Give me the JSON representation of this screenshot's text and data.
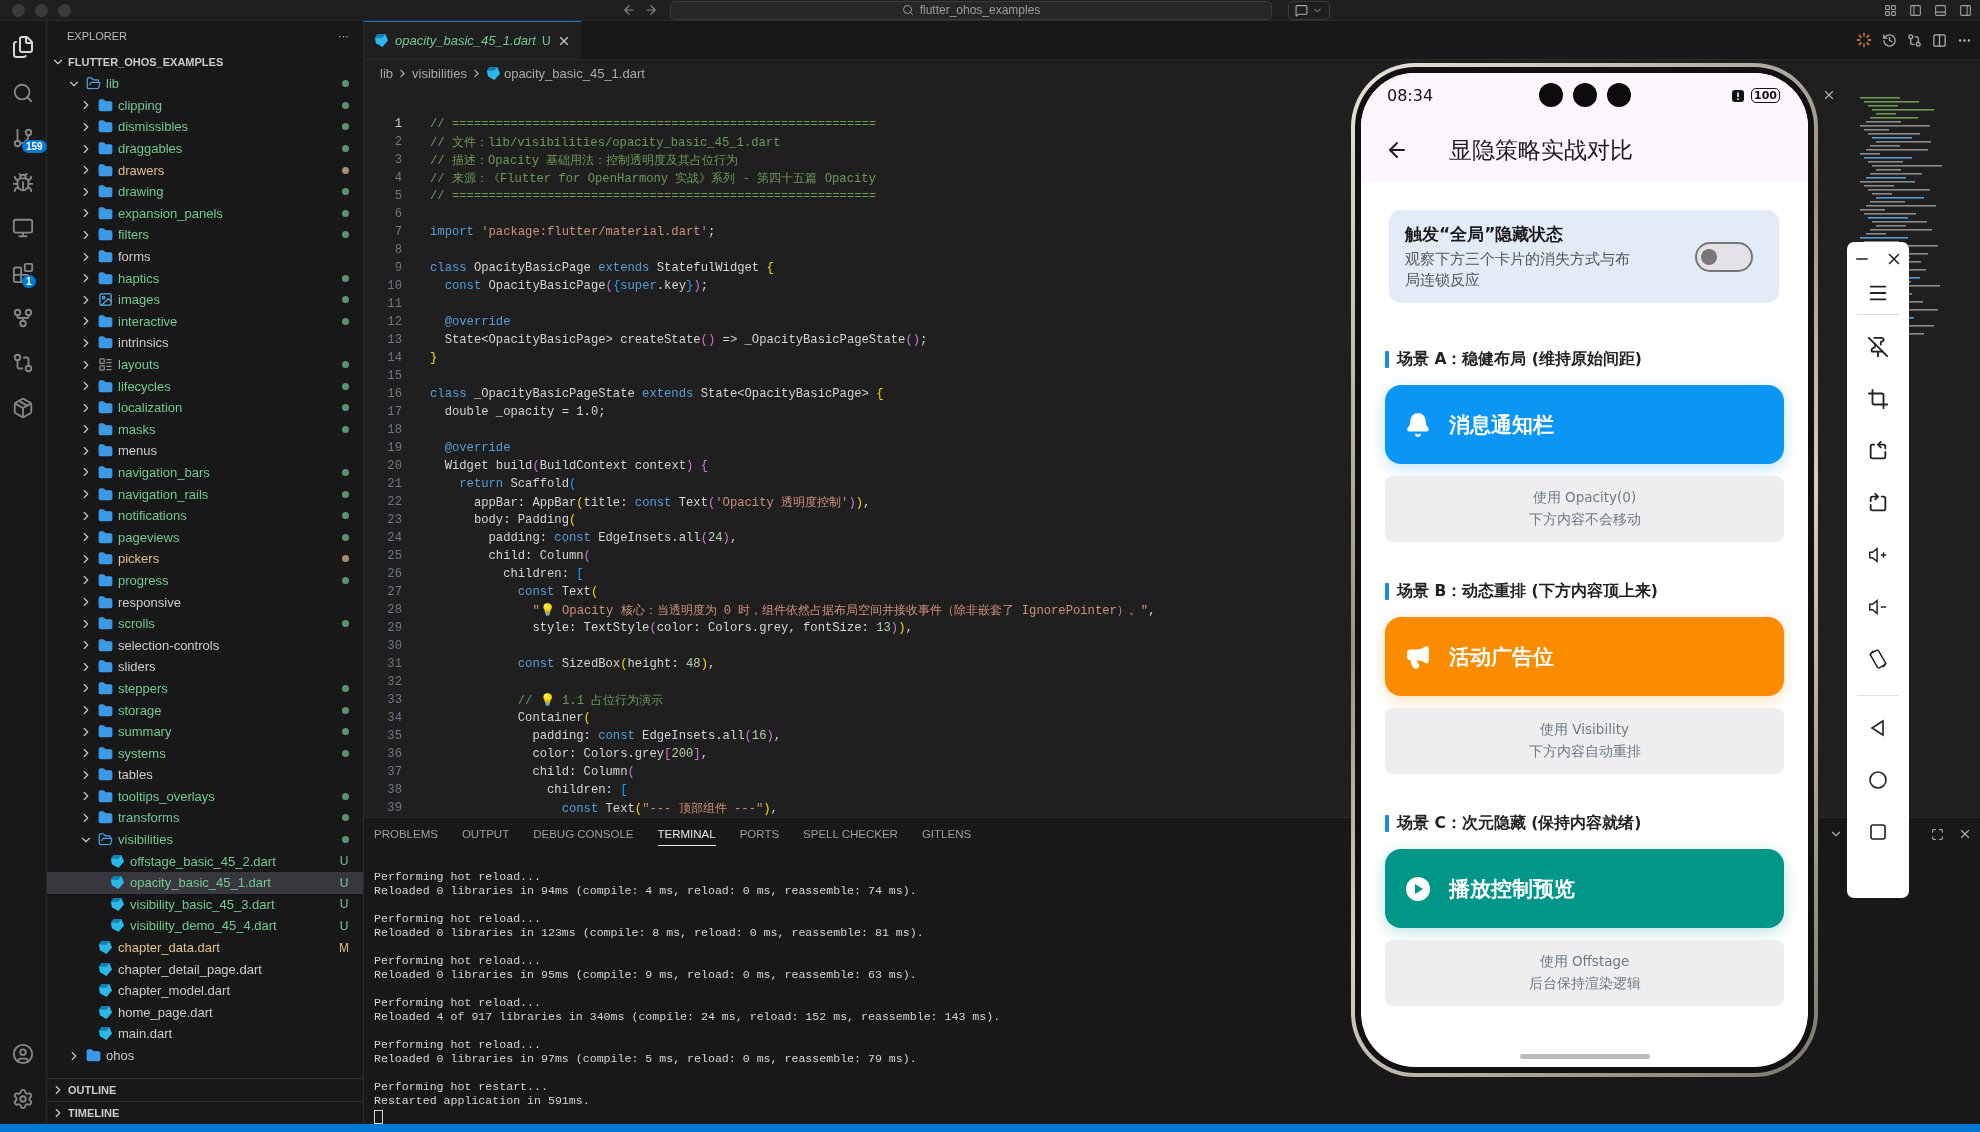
{
  "title_bar": {
    "search": "flutter_ohos_examples"
  },
  "activity_bar": {
    "badges": [
      "159",
      "1"
    ]
  },
  "explorer": {
    "header": "EXPLORER",
    "more": "···",
    "root": "FLUTTER_OHOS_EXAMPLES",
    "tree": [
      {
        "name": "lib",
        "kind": "folder",
        "expanded": true,
        "selected": false,
        "color": "#73c991",
        "dot": true,
        "children": [
          {
            "name": "clipping",
            "kind": "folder",
            "expanded": false,
            "selected": false,
            "color": "#73c991",
            "dot": true
          },
          {
            "name": "dismissibles",
            "kind": "folder",
            "expanded": false,
            "selected": false,
            "color": "#73c991",
            "dot": true
          },
          {
            "name": "draggables",
            "kind": "folder",
            "expanded": false,
            "selected": false,
            "color": "#73c991",
            "dot": true
          },
          {
            "name": "drawers",
            "kind": "folder",
            "expanded": false,
            "selected": false,
            "color": "#e2c08d",
            "dot": true
          },
          {
            "name": "drawing",
            "kind": "folder",
            "expanded": false,
            "selected": false,
            "color": "#73c991",
            "dot": true
          },
          {
            "name": "expansion_panels",
            "kind": "folder",
            "expanded": false,
            "selected": false,
            "color": "#73c991",
            "dot": true
          },
          {
            "name": "filters",
            "kind": "folder",
            "expanded": false,
            "selected": false,
            "color": "#73c991",
            "dot": true
          },
          {
            "name": "forms",
            "kind": "folder",
            "expanded": false,
            "selected": false,
            "color": "#cccccc",
            "dot": false
          },
          {
            "name": "haptics",
            "kind": "folder",
            "expanded": false,
            "selected": false,
            "color": "#73c991",
            "dot": true
          },
          {
            "name": "images",
            "kind": "imagefolder",
            "expanded": false,
            "selected": false,
            "color": "#73c991",
            "dot": true
          },
          {
            "name": "interactive",
            "kind": "folder",
            "expanded": false,
            "selected": false,
            "color": "#73c991",
            "dot": true
          },
          {
            "name": "intrinsics",
            "kind": "folder",
            "expanded": false,
            "selected": false,
            "color": "#cccccc",
            "dot": false
          },
          {
            "name": "layouts",
            "kind": "layoutfolder",
            "expanded": false,
            "selected": false,
            "color": "#73c991",
            "dot": true
          },
          {
            "name": "lifecycles",
            "kind": "folder",
            "expanded": false,
            "selected": false,
            "color": "#73c991",
            "dot": true
          },
          {
            "name": "localization",
            "kind": "folder",
            "expanded": false,
            "selected": false,
            "color": "#73c991",
            "dot": true
          },
          {
            "name": "masks",
            "kind": "folder",
            "expanded": false,
            "selected": false,
            "color": "#73c991",
            "dot": true
          },
          {
            "name": "menus",
            "kind": "folder",
            "expanded": false,
            "selected": false,
            "color": "#cccccc",
            "dot": false
          },
          {
            "name": "navigation_bars",
            "kind": "folder",
            "expanded": false,
            "selected": false,
            "color": "#73c991",
            "dot": true
          },
          {
            "name": "navigation_rails",
            "kind": "folder",
            "expanded": false,
            "selected": false,
            "color": "#73c991",
            "dot": true
          },
          {
            "name": "notifications",
            "kind": "folder",
            "expanded": false,
            "selected": false,
            "color": "#73c991",
            "dot": true
          },
          {
            "name": "pageviews",
            "kind": "folder",
            "expanded": false,
            "selected": false,
            "color": "#73c991",
            "dot": true
          },
          {
            "name": "pickers",
            "kind": "folder",
            "expanded": false,
            "selected": false,
            "color": "#e2c08d",
            "dot": true
          },
          {
            "name": "progress",
            "kind": "folder",
            "expanded": false,
            "selected": false,
            "color": "#73c991",
            "dot": true
          },
          {
            "name": "responsive",
            "kind": "folder",
            "expanded": false,
            "selected": false,
            "color": "#cccccc",
            "dot": false
          },
          {
            "name": "scrolls",
            "kind": "folder",
            "expanded": false,
            "selected": false,
            "color": "#73c991",
            "dot": true
          },
          {
            "name": "selection-controls",
            "kind": "folder",
            "expanded": false,
            "selected": false,
            "color": "#cccccc",
            "dot": false
          },
          {
            "name": "sliders",
            "kind": "folder",
            "expanded": false,
            "selected": false,
            "color": "#cccccc",
            "dot": false
          },
          {
            "name": "steppers",
            "kind": "folder",
            "expanded": false,
            "selected": false,
            "color": "#73c991",
            "dot": true
          },
          {
            "name": "storage",
            "kind": "folder",
            "expanded": false,
            "selected": false,
            "color": "#73c991",
            "dot": true
          },
          {
            "name": "summary",
            "kind": "folder",
            "expanded": false,
            "selected": false,
            "color": "#73c991",
            "dot": true
          },
          {
            "name": "systems",
            "kind": "folder",
            "expanded": false,
            "selected": false,
            "color": "#73c991",
            "dot": true
          },
          {
            "name": "tables",
            "kind": "folder",
            "expanded": false,
            "selected": false,
            "color": "#cccccc",
            "dot": false
          },
          {
            "name": "tooltips_overlays",
            "kind": "folder",
            "expanded": false,
            "selected": false,
            "color": "#73c991",
            "dot": true
          },
          {
            "name": "transforms",
            "kind": "folder",
            "expanded": false,
            "selected": false,
            "color": "#73c991",
            "dot": true
          },
          {
            "name": "visibilities",
            "kind": "folder",
            "expanded": true,
            "selected": false,
            "color": "#73c991",
            "dot": true,
            "children": [
              {
                "name": "offstage_basic_45_2.dart",
                "kind": "dart",
                "selected": false,
                "color": "#73c991",
                "badge": "U"
              },
              {
                "name": "opacity_basic_45_1.dart",
                "kind": "dart",
                "selected": true,
                "color": "#73c991",
                "badge": "U"
              },
              {
                "name": "visibility_basic_45_3.dart",
                "kind": "dart",
                "selected": false,
                "color": "#73c991",
                "badge": "U"
              },
              {
                "name": "visibility_demo_45_4.dart",
                "kind": "dart",
                "selected": false,
                "color": "#73c991",
                "badge": "U"
              }
            ]
          },
          {
            "name": "chapter_data.dart",
            "kind": "dart",
            "selected": false,
            "color": "#e2c08d",
            "badge": "M"
          },
          {
            "name": "chapter_detail_page.dart",
            "kind": "dart",
            "selected": false,
            "color": "#cccccc"
          },
          {
            "name": "chapter_model.dart",
            "kind": "dart",
            "selected": false,
            "color": "#cccccc"
          },
          {
            "name": "home_page.dart",
            "kind": "dart",
            "selected": false,
            "color": "#cccccc"
          },
          {
            "name": "main.dart",
            "kind": "dart",
            "selected": false,
            "color": "#cccccc"
          }
        ]
      },
      {
        "name": "ohos",
        "kind": "folder",
        "expanded": false,
        "selected": false,
        "color": "#cccccc",
        "dot": false
      }
    ],
    "sections": [
      "OUTLINE",
      "TIMELINE"
    ]
  },
  "editor": {
    "tab": {
      "label": "opacity_basic_45_1.dart",
      "badge": "U"
    },
    "breadcrumb": [
      "lib",
      "visibilities",
      "opacity_basic_45_1.dart"
    ],
    "lines": [
      {
        "n": "1",
        "tokens": [
          {
            "kind": "c",
            "t": "// =========================================================="
          }
        ]
      },
      {
        "n": "2",
        "tokens": [
          {
            "kind": "c",
            "t": "// 文件：lib/visibilities/opacity_basic_45_1.dart"
          }
        ]
      },
      {
        "n": "3",
        "tokens": [
          {
            "kind": "c",
            "t": "// 描述：Opacity 基础用法：控制透明度及其占位行为"
          }
        ]
      },
      {
        "n": "4",
        "tokens": [
          {
            "kind": "c",
            "t": "// 来源：《Flutter for OpenHarmony 实战》系列 - 第四十五篇 Opacity"
          }
        ]
      },
      {
        "n": "5",
        "tokens": [
          {
            "kind": "c",
            "t": "// =========================================================="
          }
        ]
      },
      {
        "n": "6"
      },
      {
        "n": "7",
        "tokens": [
          {
            "kind": "f",
            "t": "import"
          },
          {
            "kind": "s",
            "t": " 'package:flutter/material.dart'"
          },
          {
            "kind": "p",
            "t": ";"
          }
        ]
      },
      {
        "n": "8"
      },
      {
        "n": "9",
        "tokens": [
          {
            "kind": "k",
            "t": "class"
          },
          {
            "kind": "p",
            "t": " OpacityBasicPage "
          },
          {
            "kind": "k",
            "t": "extends"
          },
          {
            "kind": "p",
            "t": " StatefulWidget "
          },
          {
            "kind": "y",
            "t": "{"
          }
        ]
      },
      {
        "n": "10",
        "tokens": [
          {
            "kind": "k",
            "t": "  const"
          },
          {
            "kind": "p",
            "t": " OpacityBasicPage"
          },
          {
            "kind": "m",
            "t": "("
          },
          {
            "kind": "b",
            "t": "{"
          },
          {
            "kind": "k",
            "t": "super"
          },
          {
            "kind": "p",
            "t": ".key"
          },
          {
            "kind": "b",
            "t": "}"
          },
          {
            "kind": "m",
            "t": ")"
          },
          {
            "kind": "p",
            "t": ";"
          }
        ]
      },
      {
        "n": "11"
      },
      {
        "n": "12",
        "tokens": [
          {
            "kind": "k",
            "t": "  @override"
          }
        ]
      },
      {
        "n": "13",
        "tokens": [
          {
            "kind": "p",
            "t": "  State<OpacityBasicPage> createState"
          },
          {
            "kind": "m",
            "t": "()"
          },
          {
            "kind": "p",
            "t": " => _OpacityBasicPageState"
          },
          {
            "kind": "m",
            "t": "()"
          },
          {
            "kind": "p",
            "t": ";"
          }
        ]
      },
      {
        "n": "14",
        "tokens": [
          {
            "kind": "y",
            "t": "}"
          }
        ]
      },
      {
        "n": "15"
      },
      {
        "n": "16",
        "tokens": [
          {
            "kind": "k",
            "t": "class"
          },
          {
            "kind": "p",
            "t": " _OpacityBasicPageState "
          },
          {
            "kind": "k",
            "t": "extends"
          },
          {
            "kind": "p",
            "t": " State<OpacityBasicPage> "
          },
          {
            "kind": "y",
            "t": "{"
          }
        ]
      },
      {
        "n": "17",
        "tokens": [
          {
            "kind": "p",
            "t": "  double _opacity = 1.0;"
          }
        ]
      },
      {
        "n": "18"
      },
      {
        "n": "19",
        "tokens": [
          {
            "kind": "k",
            "t": "  @override"
          }
        ]
      },
      {
        "n": "20",
        "tokens": [
          {
            "kind": "p",
            "t": "  Widget build"
          },
          {
            "kind": "m",
            "t": "("
          },
          {
            "kind": "p",
            "t": "BuildContext context"
          },
          {
            "kind": "m",
            "t": ")"
          },
          {
            "kind": "m",
            "t": " {"
          }
        ]
      },
      {
        "n": "21",
        "tokens": [
          {
            "kind": "f",
            "t": "    return"
          },
          {
            "kind": "p",
            "t": " Scaffold"
          },
          {
            "kind": "b",
            "t": "("
          }
        ]
      },
      {
        "n": "22",
        "tokens": [
          {
            "kind": "p",
            "t": "      appBar: AppBar"
          },
          {
            "kind": "y",
            "t": "("
          },
          {
            "kind": "p",
            "t": "title: "
          },
          {
            "kind": "k",
            "t": "const"
          },
          {
            "kind": "p",
            "t": " Text"
          },
          {
            "kind": "m",
            "t": "("
          },
          {
            "kind": "s",
            "t": "'Opacity 透明度控制'"
          },
          {
            "kind": "m",
            "t": ")"
          },
          {
            "kind": "y",
            "t": ")"
          },
          {
            "kind": "p",
            "t": ","
          }
        ]
      },
      {
        "n": "23",
        "tokens": [
          {
            "kind": "p",
            "t": "      body: Padding"
          },
          {
            "kind": "y",
            "t": "("
          }
        ]
      },
      {
        "n": "24",
        "tokens": [
          {
            "kind": "p",
            "t": "        padding: "
          },
          {
            "kind": "k",
            "t": "const"
          },
          {
            "kind": "p",
            "t": " EdgeInsets.all"
          },
          {
            "kind": "m",
            "t": "("
          },
          {
            "kind": "n",
            "t": "24"
          },
          {
            "kind": "m",
            "t": ")"
          },
          {
            "kind": "p",
            "t": ","
          }
        ]
      },
      {
        "n": "25",
        "tokens": [
          {
            "kind": "p",
            "t": "        child: Column"
          },
          {
            "kind": "m",
            "t": "("
          }
        ]
      },
      {
        "n": "26",
        "tokens": [
          {
            "kind": "p",
            "t": "          children: "
          },
          {
            "kind": "b",
            "t": "["
          }
        ]
      },
      {
        "n": "27",
        "tokens": [
          {
            "kind": "k",
            "t": "            const"
          },
          {
            "kind": "p",
            "t": " Text"
          },
          {
            "kind": "y",
            "t": "("
          }
        ]
      },
      {
        "n": "28",
        "tokens": [
          {
            "kind": "s",
            "t": "              \"💡 Opacity 核心：当透明度为 0 时，组件依然占据布局空间并接收事件（除非嵌套了 IgnorePointer）。\""
          },
          {
            "kind": "p",
            "t": ","
          }
        ]
      },
      {
        "n": "29",
        "tokens": [
          {
            "kind": "p",
            "t": "              style: TextStyle"
          },
          {
            "kind": "m",
            "t": "("
          },
          {
            "kind": "p",
            "t": "color: Colors.grey, fontSize: "
          },
          {
            "kind": "n",
            "t": "13"
          },
          {
            "kind": "m",
            "t": ")"
          },
          {
            "kind": "y",
            "t": ")"
          },
          {
            "kind": "p",
            "t": ","
          }
        ]
      },
      {
        "n": "30"
      },
      {
        "n": "31",
        "tokens": [
          {
            "kind": "k",
            "t": "            const"
          },
          {
            "kind": "p",
            "t": " SizedBox"
          },
          {
            "kind": "y",
            "t": "("
          },
          {
            "kind": "p",
            "t": "height: "
          },
          {
            "kind": "n",
            "t": "48"
          },
          {
            "kind": "y",
            "t": ")"
          },
          {
            "kind": "p",
            "t": ","
          }
        ]
      },
      {
        "n": "32"
      },
      {
        "n": "33",
        "tokens": [
          {
            "kind": "c",
            "t": "            // 💡 1.1 占位行为演示"
          }
        ]
      },
      {
        "n": "34",
        "tokens": [
          {
            "kind": "p",
            "t": "            Container"
          },
          {
            "kind": "y",
            "t": "("
          }
        ]
      },
      {
        "n": "35",
        "tokens": [
          {
            "kind": "p",
            "t": "              padding: "
          },
          {
            "kind": "k",
            "t": "const"
          },
          {
            "kind": "p",
            "t": " EdgeInsets.all"
          },
          {
            "kind": "m",
            "t": "("
          },
          {
            "kind": "n",
            "t": "16"
          },
          {
            "kind": "m",
            "t": ")"
          },
          {
            "kind": "p",
            "t": ","
          }
        ]
      },
      {
        "n": "36",
        "tokens": [
          {
            "kind": "p",
            "t": "              color: Colors.grey"
          },
          {
            "kind": "m",
            "t": "["
          },
          {
            "kind": "n",
            "t": "200"
          },
          {
            "kind": "m",
            "t": "]"
          },
          {
            "kind": "p",
            "t": ","
          }
        ]
      },
      {
        "n": "37",
        "tokens": [
          {
            "kind": "p",
            "t": "              child: Column"
          },
          {
            "kind": "m",
            "t": "("
          }
        ]
      },
      {
        "n": "38",
        "tokens": [
          {
            "kind": "p",
            "t": "                children: "
          },
          {
            "kind": "b",
            "t": "["
          }
        ]
      },
      {
        "n": "39",
        "tokens": [
          {
            "kind": "k",
            "t": "                  const"
          },
          {
            "kind": "p",
            "t": " Text"
          },
          {
            "kind": "y",
            "t": "("
          },
          {
            "kind": "s",
            "t": "\"--- 顶部组件 ---\""
          },
          {
            "kind": "y",
            "t": ")"
          },
          {
            "kind": "p",
            "t": ","
          }
        ]
      }
    ]
  },
  "panel": {
    "tabs": [
      {
        "label": "PROBLEMS",
        "selected": false
      },
      {
        "label": "OUTPUT",
        "selected": false
      },
      {
        "label": "DEBUG CONSOLE",
        "selected": false
      },
      {
        "label": "TERMINAL",
        "selected": true
      },
      {
        "label": "PORTS",
        "selected": false
      },
      {
        "label": "SPELL CHECKER",
        "selected": false
      },
      {
        "label": "GITLENS",
        "selected": false
      }
    ],
    "terminal": [
      {
        "command": "Performing hot reload...",
        "result": "Reloaded 0 libraries in 94ms (compile: 4 ms, reload: 0 ms, reassemble: 74 ms)."
      },
      {
        "command": "Performing hot reload...",
        "result": "Reloaded 0 libraries in 123ms (compile: 8 ms, reload: 0 ms, reassemble: 81 ms)."
      },
      {
        "command": "Performing hot reload...",
        "result": "Reloaded 0 libraries in 95ms (compile: 9 ms, reload: 0 ms, reassemble: 63 ms)."
      },
      {
        "command": "Performing hot reload...",
        "result": "Reloaded 4 of 917 libraries in 340ms (compile: 24 ms, reload: 152 ms, reassemble: 143 ms)."
      },
      {
        "command": "Performing hot reload...",
        "result": "Reloaded 0 libraries in 97ms (compile: 5 ms, reload: 0 ms, reassemble: 79 ms)."
      },
      {
        "command": "Performing hot restart...",
        "result": "Restarted application in 591ms."
      }
    ]
  },
  "phone": {
    "status_bar": {
      "time": "08:34",
      "battery": "100"
    },
    "app_bar": {
      "title": "显隐策略实战对比"
    },
    "toggle_card": {
      "title": "触发“全局”隐藏状态",
      "subtitle": "观察下方三个卡片的消失方式与布局连锁反应",
      "on": false
    },
    "sections": [
      {
        "label": "场景 A：稳健布局 (维持原始间距)",
        "banner": {
          "text": "消息通知栏",
          "color": "#0996f5"
        },
        "note": [
          "使用 Opacity(0)",
          "下方内容不会移动"
        ]
      },
      {
        "label": "场景 B：动态重排 (下方内容顶上来)",
        "banner": {
          "text": "活动广告位",
          "color": "#fb8c00"
        },
        "note": [
          "使用 Visibility",
          "下方内容自动重排"
        ]
      },
      {
        "label": "场景 C：次元隐藏 (保持内容就绪)",
        "banner": {
          "text": "播放控制预览",
          "color": "#009688"
        },
        "note": [
          "使用 Offstage",
          "后台保持渲染逻辑"
        ]
      }
    ]
  }
}
